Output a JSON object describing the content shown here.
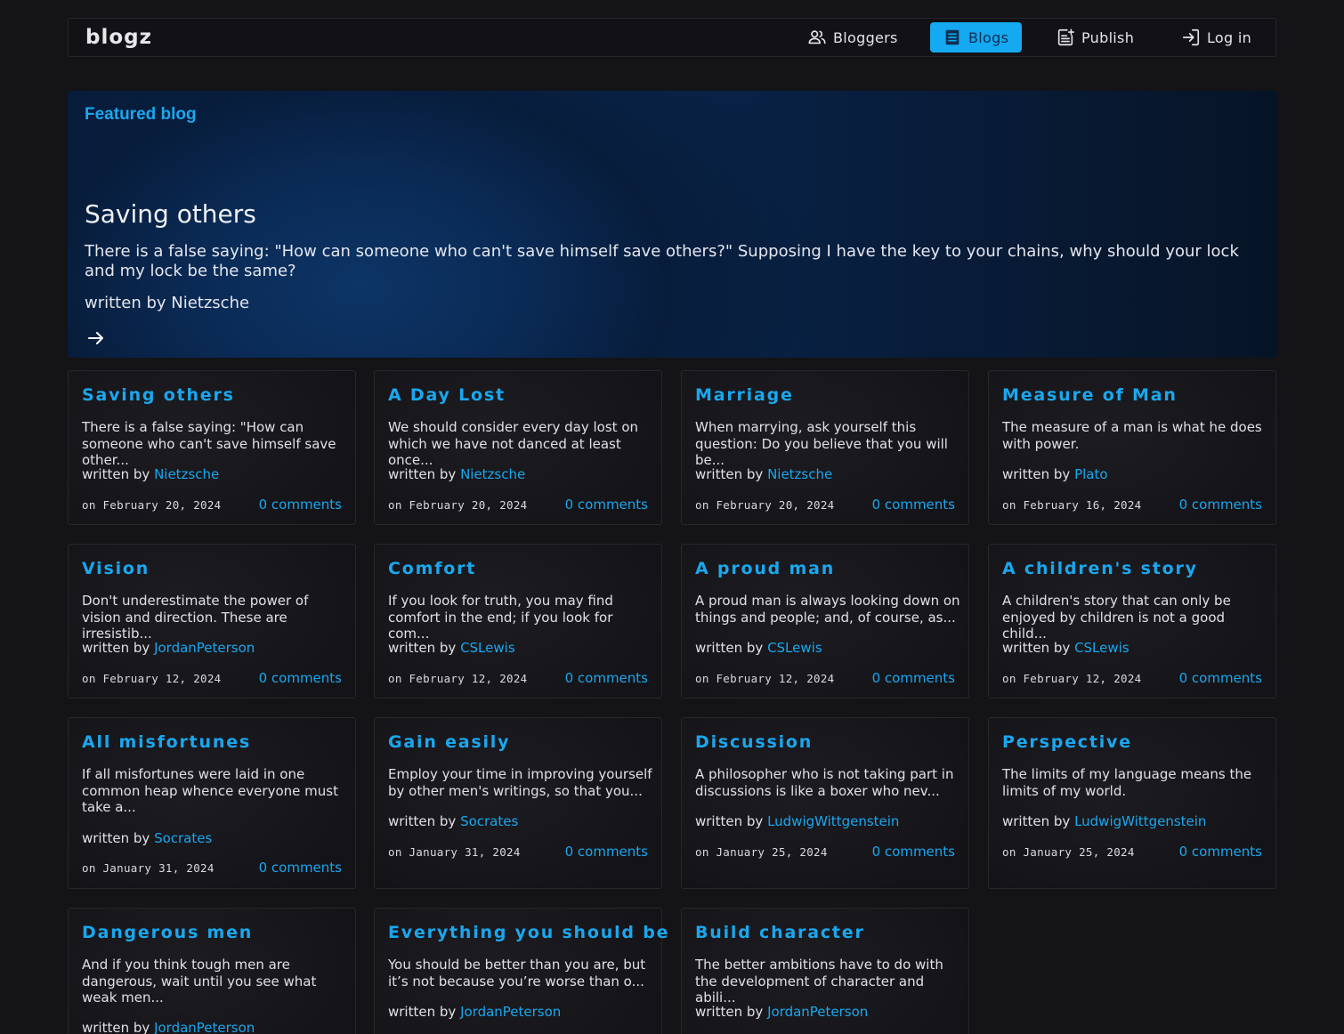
{
  "brand": "blogz",
  "nav": {
    "bloggers": "Bloggers",
    "blogs": "Blogs",
    "publish": "Publish",
    "login": "Log in"
  },
  "colors": {
    "accent": "#1aa7ee",
    "active_nav_bg": "#14a9f0",
    "background": "#141316"
  },
  "featured": {
    "kicker": "Featured blog",
    "title": "Saving others",
    "excerpt": "There is a false saying: \"How can someone who can't save himself save others?\" Supposing I have the key to your chains, why should your lock and my lock be the same?",
    "author_line": "written by Nietzsche",
    "arrow_icon": "arrow-right-icon"
  },
  "cards": [
    {
      "title": "Saving others",
      "excerpt": "There is a false saying: \"How can someone who can't save himself save other...",
      "author_prefix": "written by",
      "author": "Nietzsche",
      "date": "on February 20, 2024",
      "comments": "0 comments"
    },
    {
      "title": "A Day Lost",
      "excerpt": "We should consider every day lost on which we have not danced at least once...",
      "author_prefix": "written by",
      "author": "Nietzsche",
      "date": "on February 20, 2024",
      "comments": "0 comments"
    },
    {
      "title": "Marriage",
      "excerpt": "When marrying, ask yourself this question: Do you believe that you will be...",
      "author_prefix": "written by",
      "author": "Nietzsche",
      "date": "on February 20, 2024",
      "comments": "0 comments"
    },
    {
      "title": "Measure of Man",
      "excerpt": "The measure of a man is what he does with power.",
      "author_prefix": "written by",
      "author": "Plato",
      "date": "on February 16, 2024",
      "comments": "0 comments"
    },
    {
      "title": "Vision",
      "excerpt": "Don't underestimate the power of vision and direction. These are irresistib...",
      "author_prefix": "written by",
      "author": "JordanPeterson",
      "date": "on February 12, 2024",
      "comments": "0 comments"
    },
    {
      "title": "Comfort",
      "excerpt": "If you look for truth, you may find comfort in the end; if you look for com...",
      "author_prefix": "written by",
      "author": "CSLewis",
      "date": "on February 12, 2024",
      "comments": "0 comments"
    },
    {
      "title": "A proud man",
      "excerpt": "A proud man is always looking down on things and people; and, of course, as...",
      "author_prefix": "written by",
      "author": "CSLewis",
      "date": "on February 12, 2024",
      "comments": "0 comments"
    },
    {
      "title": "A children's story",
      "excerpt": "A children's story that can only be enjoyed by children is not a good child...",
      "author_prefix": "written by",
      "author": "CSLewis",
      "date": "on February 12, 2024",
      "comments": "0 comments"
    },
    {
      "title": "All misfortunes",
      "excerpt": "If all misfortunes were laid in one common heap whence everyone must take a...",
      "author_prefix": "written by",
      "author": "Socrates",
      "date": "on January 31, 2024",
      "comments": "0 comments"
    },
    {
      "title": "Gain easily",
      "excerpt": "Employ your time in improving yourself by other men's writings, so that you...",
      "author_prefix": "written by",
      "author": "Socrates",
      "date": "on January 31, 2024",
      "comments": "0 comments"
    },
    {
      "title": "Discussion",
      "excerpt": "A philosopher who is not taking part in discussions is like a boxer who nev...",
      "author_prefix": "written by",
      "author": "LudwigWittgenstein",
      "date": "on January 25, 2024",
      "comments": "0 comments"
    },
    {
      "title": "Perspective",
      "excerpt": "The limits of my language means the limits of my world.",
      "author_prefix": "written by",
      "author": "LudwigWittgenstein",
      "date": "on January 25, 2024",
      "comments": "0 comments"
    },
    {
      "title": "Dangerous men",
      "excerpt": "And if you think tough men are dangerous, wait until you see what weak men...",
      "author_prefix": "written by",
      "author": "JordanPeterson",
      "date": "",
      "comments": ""
    },
    {
      "title": "Everything you should be",
      "excerpt": "You should be better than you are, but it’s not because you’re worse than o...",
      "author_prefix": "written by",
      "author": "JordanPeterson",
      "date": "",
      "comments": ""
    },
    {
      "title": "Build character",
      "excerpt": "The better ambitions have to do with the development of character and abili...",
      "author_prefix": "written by",
      "author": "JordanPeterson",
      "date": "",
      "comments": ""
    }
  ]
}
